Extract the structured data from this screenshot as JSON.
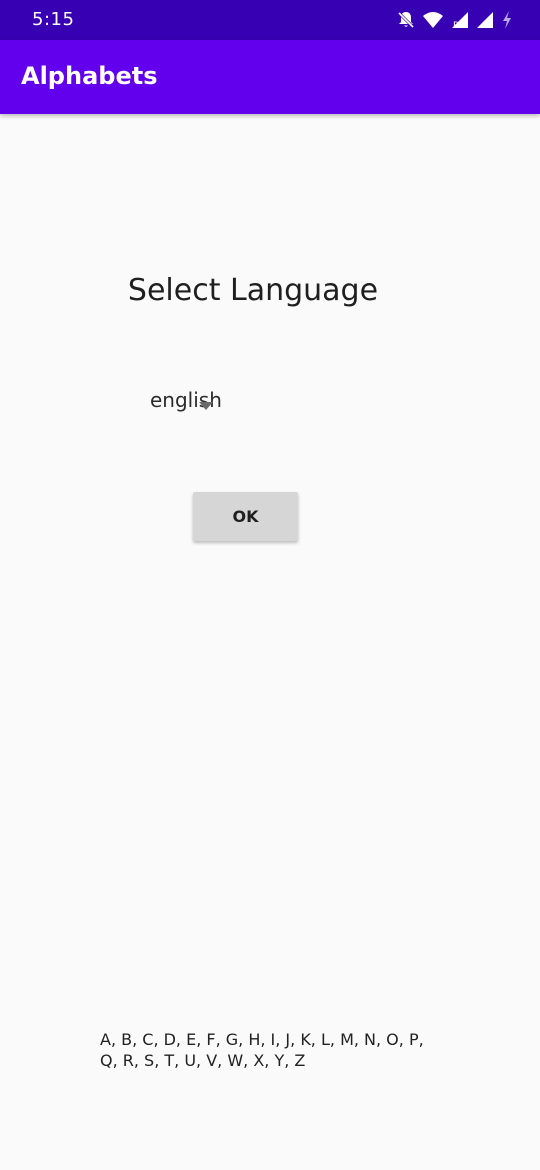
{
  "status_bar": {
    "time": "5:15",
    "icons": [
      "bell-off-icon",
      "wifi-icon",
      "signal-roaming-icon",
      "signal-icon",
      "battery-charging-icon"
    ],
    "background": "#3700b3"
  },
  "app_bar": {
    "title": "Alphabets",
    "background": "#6200ee"
  },
  "main": {
    "heading": "Select Language",
    "language_select": {
      "selected": "english",
      "icon": "dropdown-arrow-icon"
    },
    "ok_button_label": "OK",
    "alphabet_text": "A, B, C, D, E, F, G, H, I, J, K, L, M, N, O, P, Q, R, S, T, U, V, W, X, Y, Z"
  }
}
